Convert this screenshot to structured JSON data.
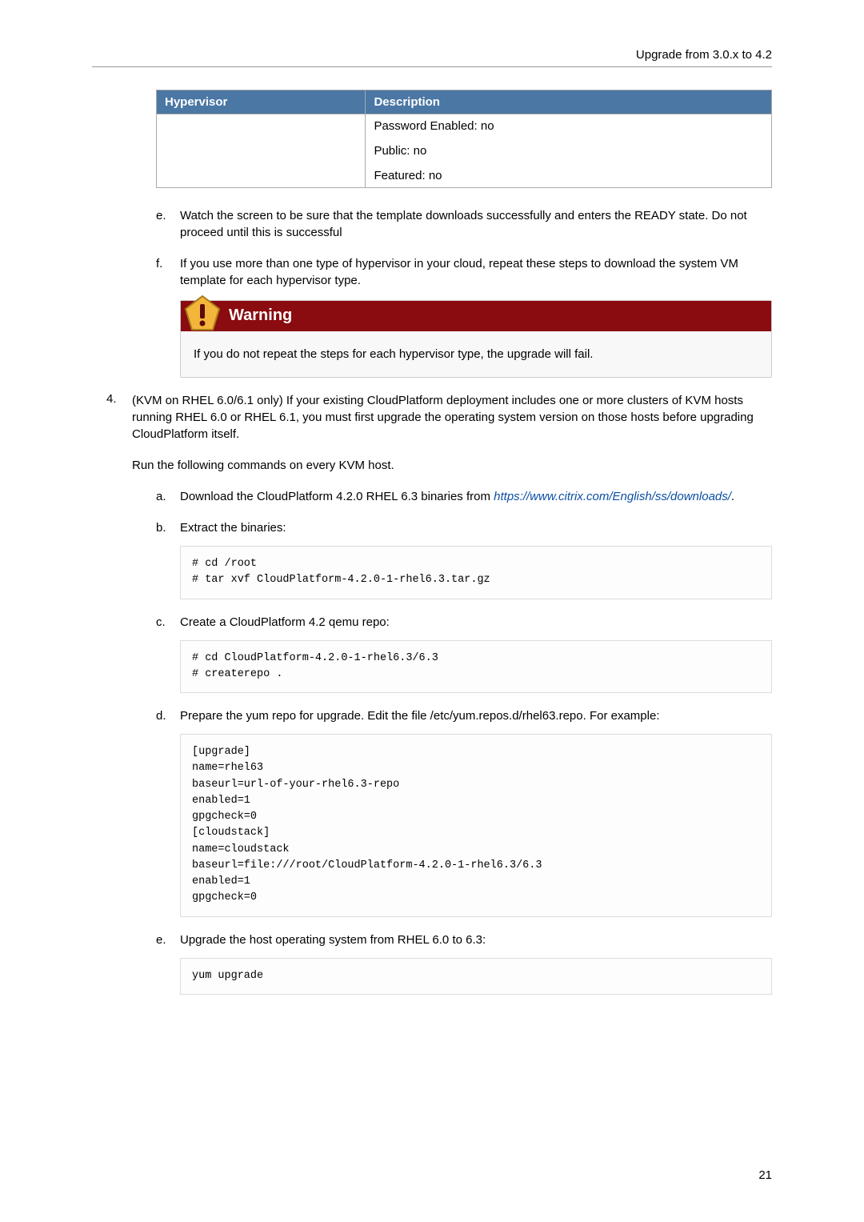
{
  "header": "Upgrade from 3.0.x to 4.2",
  "page_number": "21",
  "table": {
    "col1": "Hypervisor",
    "col2": "Description",
    "cell_lines": [
      "Password Enabled: no",
      "Public: no",
      "Featured: no"
    ]
  },
  "steps_ef": {
    "e": {
      "marker": "e.",
      "text": "Watch the screen to be sure that the template downloads successfully and enters the READY state. Do not proceed until this is successful"
    },
    "f": {
      "marker": "f.",
      "text": "If you use more than one type of hypervisor in your cloud, repeat these steps to download the system VM template for each hypervisor type."
    }
  },
  "warning": {
    "title": "Warning",
    "body": "If you do not repeat the steps for each hypervisor type, the upgrade will fail."
  },
  "step4": {
    "marker": "4.",
    "intro": "(KVM on RHEL 6.0/6.1 only) If your existing CloudPlatform deployment includes one or more clusters of KVM hosts running RHEL 6.0 or RHEL 6.1, you must first upgrade the operating system version on those hosts before upgrading CloudPlatform itself.",
    "run_line": "Run the following commands on every KVM host.",
    "sub": {
      "a": {
        "marker": "a.",
        "pre": "Download the CloudPlatform 4.2.0 RHEL 6.3 binaries from ",
        "link": "https://www.citrix.com/English/ss/downloads/",
        "post": "."
      },
      "b": {
        "marker": "b.",
        "text": "Extract the binaries:",
        "code": "# cd /root\n# tar xvf CloudPlatform-4.2.0-1-rhel6.3.tar.gz"
      },
      "c": {
        "marker": "c.",
        "text": "Create a CloudPlatform 4.2 qemu repo:",
        "code": "# cd CloudPlatform-4.2.0-1-rhel6.3/6.3\n# createrepo ."
      },
      "d": {
        "marker": "d.",
        "text": "Prepare the yum repo for upgrade. Edit the file /etc/yum.repos.d/rhel63.repo. For example:",
        "code": "[upgrade]\nname=rhel63\nbaseurl=url-of-your-rhel6.3-repo\nenabled=1\ngpgcheck=0\n[cloudstack]\nname=cloudstack\nbaseurl=file:///root/CloudPlatform-4.2.0-1-rhel6.3/6.3\nenabled=1\ngpgcheck=0"
      },
      "e": {
        "marker": "e.",
        "text": "Upgrade the host operating system from RHEL 6.0 to 6.3:",
        "code": "yum upgrade"
      }
    }
  }
}
